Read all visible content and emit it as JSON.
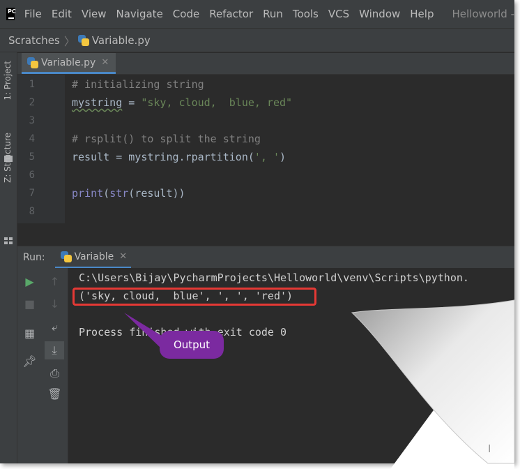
{
  "menubar": {
    "items": [
      "File",
      "Edit",
      "View",
      "Navigate",
      "Code",
      "Refactor",
      "Run",
      "Tools",
      "VCS",
      "Window",
      "Help"
    ],
    "window_title": "Helloworld -"
  },
  "navbar": {
    "crumb1": "Scratches",
    "crumb2": "Variable.py"
  },
  "left_strip": {
    "project_tab": "1: Project",
    "structure_tab": "Z: Structure"
  },
  "editor": {
    "tab_label": "Variable.py",
    "lines": [
      {
        "n": "1"
      },
      {
        "n": "2"
      },
      {
        "n": "3"
      },
      {
        "n": "4"
      },
      {
        "n": "5"
      },
      {
        "n": "6"
      },
      {
        "n": "7"
      },
      {
        "n": "8"
      }
    ],
    "code": {
      "l1": "# initializing string",
      "l2_var": "mystring",
      "l2_eq": " = ",
      "l2_str": "\"sky, cloud,  blue, red\"",
      "l4": "# rsplit() to split the string",
      "l5_a": "result = mystring.rpartition(",
      "l5_str": "', '",
      "l5_b": ")",
      "l7_print": "print",
      "l7_open": "(",
      "l7_str": "str",
      "l7_rest": "(result))"
    }
  },
  "run_panel": {
    "label": "Run:",
    "tab_label": "Variable",
    "console": {
      "line1": "C:\\Users\\Bijay\\PycharmProjects\\Helloworld\\venv\\Scripts\\python.",
      "line2": "('sky, cloud,  blue', ', ', 'red')",
      "line4": "Process finished with exit code 0"
    }
  },
  "annotation": {
    "callout": "Output"
  },
  "colors": {
    "highlight_box": "#e53935",
    "callout": "#7b2aa0",
    "accent": "#4a88c7"
  }
}
